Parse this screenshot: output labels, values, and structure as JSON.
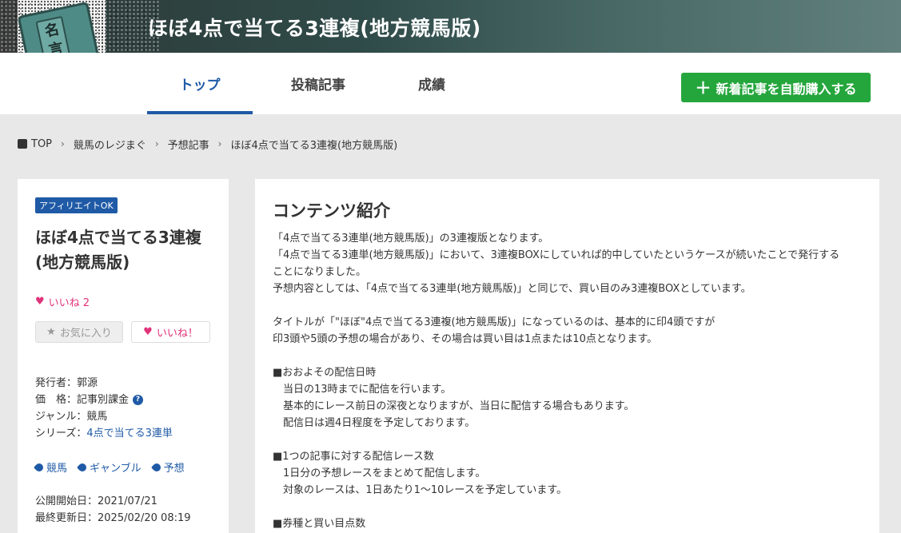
{
  "header": {
    "site_title": "ほぼ4点で当てる3連複(地方競馬版)",
    "logo_text": "名言集"
  },
  "nav": {
    "tabs": [
      {
        "label": "トップ",
        "active": true
      },
      {
        "label": "投稿記事",
        "active": false
      },
      {
        "label": "成績",
        "active": false
      }
    ],
    "buy_button": "新着記事を自動購入する"
  },
  "breadcrumb": [
    "TOP",
    "競馬のレジまぐ",
    "予想記事",
    "ほぼ4点で当てる3連複(地方競馬版)"
  ],
  "sidebar": {
    "badge": "アフィリエイトOK",
    "title": "ほぼ4点で当てる3連複(地方競馬版)",
    "likes_label": "いいね 2",
    "fav_button": "お気に入り",
    "like_button": "いいね！",
    "publisher_label": "発行者：郭源",
    "price_label": "価　格：記事別課金",
    "genre_label": "ジャンル：競馬",
    "series_prefix": "シリーズ：",
    "series_link": "4点で当てる3連単",
    "tags": [
      "競馬",
      "ギャンブル",
      "予想"
    ],
    "published": "公開開始日：2021/07/21",
    "updated": "最終更新日：2025/02/20 08:19"
  },
  "content": {
    "heading": "コンテンツ紹介",
    "lines": [
      "「4点で当てる3連単(地方競馬版)」の3連複版となります。",
      "「4点で当てる3連単(地方競馬版)」において、3連複BOXにしていれば的中していたというケースが続いたことで発行する",
      "ことになりました。",
      "予想内容としては、「4点で当てる3連単(地方競馬版)」と同じで、買い目のみ3連複BOXとしています。",
      "",
      "タイトルが「\"ほぼ\"4点で当てる3連複(地方競馬版)」になっているのは、基本的に印4頭ですが",
      "印3頭や5頭の予想の場合があり、その場合は買い目は1点または10点となります。",
      "",
      "■おおよその配信日時",
      "　当日の13時までに配信を行います。",
      "　基本的にレース前日の深夜となりますが、当日に配信する場合もあります。",
      "　配信日は週4日程度を予定しております。",
      "",
      "■1つの記事に対する配信レース数",
      "　1日分の予想レースをまとめて配信します。",
      "　対象のレースは、1日あたり1～10レースを予定しています。",
      "",
      "■券種と買い目点数"
    ]
  },
  "colors": {
    "accent_blue": "#1f5aa6",
    "buy_green": "#25a63d",
    "like_pink": "#e0337a"
  }
}
